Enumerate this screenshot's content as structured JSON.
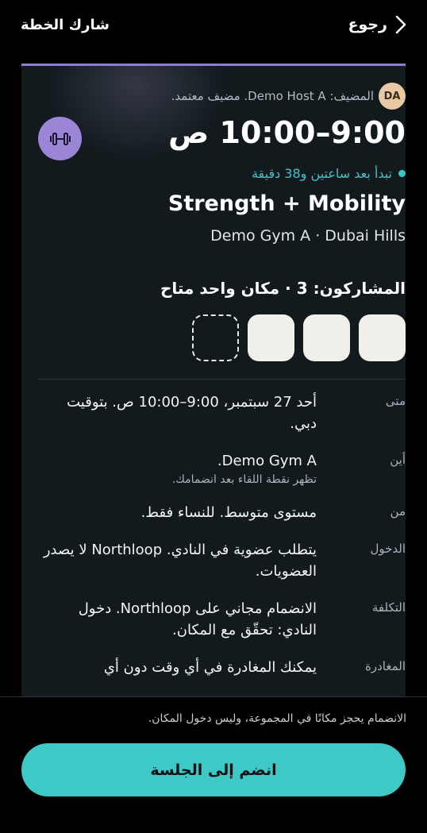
{
  "header": {
    "back_label": "رجوع",
    "share_label": "شارك الخطة"
  },
  "session": {
    "host_initials": "DA",
    "host_text": "المضيف: Demo Host A. مضيف معتمد.",
    "time": "9:00–10:00 ص",
    "category_icon": "dumbbell-icon",
    "starts_in": "تبدأ بعد ساعتين و38 دقيقة",
    "title": "Strength + Mobility",
    "location": "Demo Gym A · Dubai Hills",
    "participants_title": "المشاركون: 3 · مكان واحد متاح",
    "slots": {
      "filled": 3,
      "open": 1
    }
  },
  "details": [
    {
      "key": "متى",
      "main": "أحد 27 سبتمبر، 9:00–10:00 ص. بتوقيت دبي.",
      "sub": ""
    },
    {
      "key": "أين",
      "main": "Demo Gym A.",
      "sub": "تظهر نقطة اللقاء بعد انضمامك."
    },
    {
      "key": "من",
      "main": "مستوى متوسط. للنساء فقط.",
      "sub": ""
    },
    {
      "key": "الدخول",
      "main": "يتطلب عضوية في النادي. Northloop لا يصدر العضويات.",
      "sub": ""
    },
    {
      "key": "التكلفة",
      "main": "الانضمام مجاني على Northloop. دخول النادي: تحقّق مع المكان.",
      "sub": ""
    },
    {
      "key": "المغادرة",
      "main": "يمكنك المغادرة في أي وقت دون أي",
      "sub": ""
    }
  ],
  "footer": {
    "notice": "الانضمام يحجز مكانًا في المجموعة، وليس دخول المكان.",
    "join_label": "انضم إلى الجلسة"
  },
  "colors": {
    "accent": "#3fc9c6",
    "card_border": "#8a7fd0",
    "badge": "#9b85d6",
    "avatar": "#e8c9a3"
  }
}
